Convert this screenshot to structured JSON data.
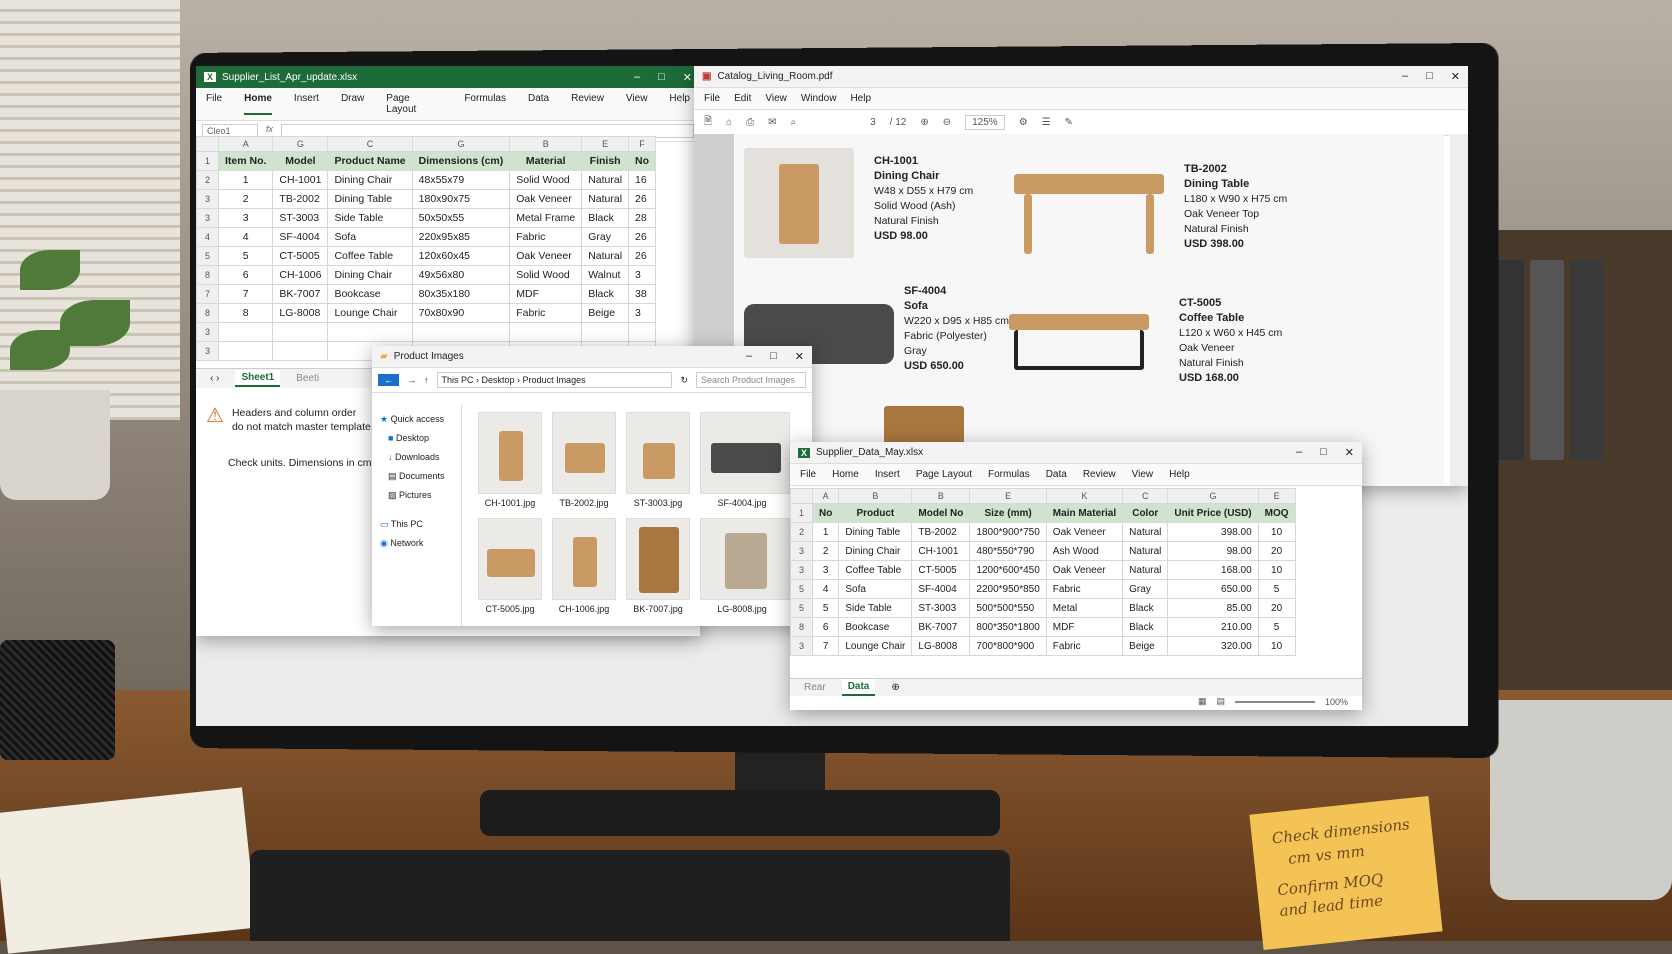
{
  "excel1": {
    "title": "Supplier_List_Apr_update.xlsx",
    "menu": [
      "File",
      "Home",
      "Insert",
      "Draw",
      "Page Layout",
      "Formulas",
      "Data",
      "Review",
      "View",
      "Help"
    ],
    "namebox": "Cleo1",
    "fx": "fx",
    "col_letters": [
      "A",
      "G",
      "C",
      "G",
      "B",
      "E",
      "F"
    ],
    "headers": [
      "Item No.",
      "Model",
      "Product Name",
      "Dimensions (cm)",
      "Material",
      "Finish",
      "No"
    ],
    "row_nums": [
      "1",
      "2",
      "3",
      "3",
      "4",
      "5",
      "8",
      "7",
      "8",
      "3",
      "3",
      "8"
    ],
    "rows": [
      [
        "1",
        "CH-1001",
        "Dining Chair",
        "48x55x79",
        "Solid Wood",
        "Natural",
        "16"
      ],
      [
        "2",
        "TB-2002",
        "Dining Table",
        "180x90x75",
        "Oak Veneer",
        "Natural",
        "26"
      ],
      [
        "3",
        "ST-3003",
        "Side Table",
        "50x50x55",
        "Metal Frame",
        "Black",
        "28"
      ],
      [
        "4",
        "SF-4004",
        "Sofa",
        "220x95x85",
        "Fabric",
        "Gray",
        "26"
      ],
      [
        "5",
        "CT-5005",
        "Coffee Table",
        "120x60x45",
        "Oak Veneer",
        "Natural",
        "26"
      ],
      [
        "6",
        "CH-1006",
        "Dining Chair",
        "49x56x80",
        "Solid Wood",
        "Walnut",
        "3"
      ],
      [
        "7",
        "BK-7007",
        "Bookcase",
        "80x35x180",
        "MDF",
        "Black",
        "38"
      ],
      [
        "8",
        "LG-8008",
        "Lounge Chair",
        "70x80x90",
        "Fabric",
        "Beige",
        "3"
      ]
    ],
    "sheet_tab": "Sheet1",
    "sheet_tab2": "Beeti",
    "warning_line1": "Headers and column order",
    "warning_line2": "do not match master template.",
    "note": "Check units. Dimensions in cm."
  },
  "pdf": {
    "title": "Catalog_Living_Room.pdf",
    "menu": [
      "File",
      "Edit",
      "View",
      "Window",
      "Help"
    ],
    "page": "3",
    "page_total": "/ 12",
    "zoom": "125%",
    "products": [
      {
        "code": "CH-1001",
        "name": "Dining Chair",
        "l1": "W48 x D55 x H79 cm",
        "l2": "Solid Wood (Ash)",
        "l3": "Natural Finish",
        "price": "USD 98.00"
      },
      {
        "code": "TB-2002",
        "name": "Dining Table",
        "l1": "L180 x W90 x H75 cm",
        "l2": "Oak Veneer Top",
        "l3": "Natural Finish",
        "price": "USD 398.00"
      },
      {
        "code": "SF-4004",
        "name": "Sofa",
        "l1": "W220 x D95 x H85 cm",
        "l2": "Fabric (Polyester)",
        "l3": "Gray",
        "price": "USD 650.00"
      },
      {
        "code": "CT-5005",
        "name": "Coffee Table",
        "l1": "L120 x W60 x H45 cm",
        "l2": "Oak Veneer",
        "l3": "Natural Finish",
        "price": "USD 168.00"
      }
    ]
  },
  "explorer": {
    "title": "Product Images",
    "breadcrumb": [
      "This PC",
      "Desktop",
      "Product Images"
    ],
    "search_placeholder": "Search Product Images",
    "sidebar": [
      "Quick access",
      "Desktop",
      "Downloads",
      "Documents",
      "Pictures",
      "This PC",
      "Network"
    ],
    "files": [
      "CH-1001.jpg",
      "TB-2002.jpg",
      "ST-3003.jpg",
      "SF-4004.jpg",
      "CT-5005.jpg",
      "CH-1006.jpg",
      "BK-7007.jpg",
      "LG-8008.jpg"
    ]
  },
  "excel2": {
    "title": "Supplier_Data_May.xlsx",
    "menu": [
      "File",
      "Home",
      "Insert",
      "Page Layout",
      "Formulas",
      "Data",
      "Review",
      "View",
      "Help"
    ],
    "col_letters": [
      "A",
      "B",
      "B",
      "E",
      "K",
      "C",
      "G",
      "E"
    ],
    "headers": [
      "No",
      "Product",
      "Model No",
      "Size (mm)",
      "Main Material",
      "Color",
      "Unit Price (USD)",
      "MOQ"
    ],
    "row_nums": [
      "1",
      "2",
      "3",
      "3",
      "5",
      "5",
      "8",
      "3",
      "8"
    ],
    "rows": [
      [
        "1",
        "Dining Table",
        "TB-2002",
        "1800*900*750",
        "Oak Veneer",
        "Natural",
        "398.00",
        "10"
      ],
      [
        "2",
        "Dining Chair",
        "CH-1001",
        "480*550*790",
        "Ash Wood",
        "Natural",
        "98.00",
        "20"
      ],
      [
        "3",
        "Coffee Table",
        "CT-5005",
        "1200*600*450",
        "Oak Veneer",
        "Natural",
        "168.00",
        "10"
      ],
      [
        "4",
        "Sofa",
        "SF-4004",
        "2200*950*850",
        "Fabric",
        "Gray",
        "650.00",
        "5"
      ],
      [
        "5",
        "Side Table",
        "ST-3003",
        "500*500*550",
        "Metal",
        "Black",
        "85.00",
        "20"
      ],
      [
        "6",
        "Bookcase",
        "BK-7007",
        "800*350*1800",
        "MDF",
        "Black",
        "210.00",
        "5"
      ],
      [
        "7",
        "Lounge Chair",
        "LG-8008",
        "700*800*900",
        "Fabric",
        "Beige",
        "320.00",
        "10"
      ]
    ],
    "sheet_tab": "Data",
    "sheet_tab_prev": "Rear",
    "zoom": "100%"
  },
  "sticky": {
    "line1": "Check dimensions",
    "line2": "cm vs mm",
    "line3": "Confirm MOQ",
    "line4": "and lead time"
  }
}
